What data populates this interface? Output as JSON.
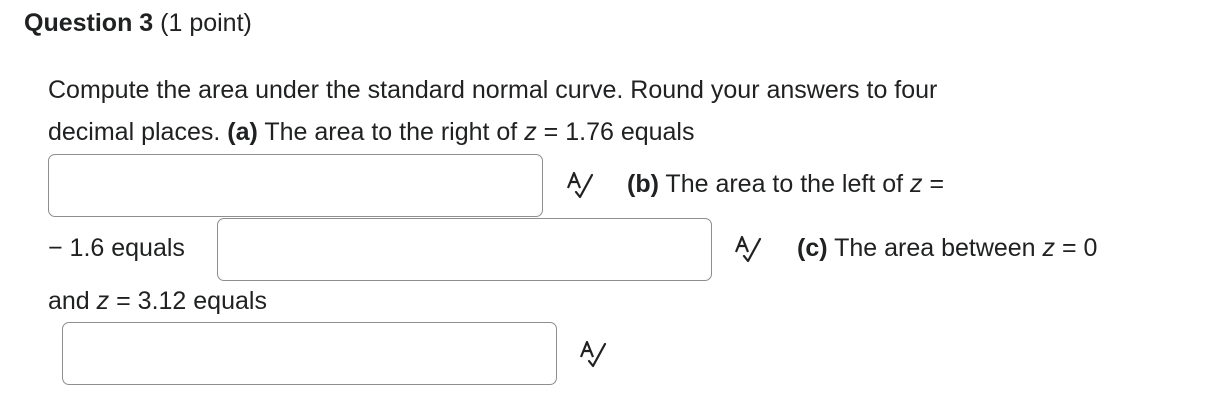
{
  "question": {
    "title": "Question 3",
    "points": "(1 point)"
  },
  "prompt": {
    "line1": "Compute the area under the standard normal curve. Round your answers to four",
    "line2_pre": "decimal places.",
    "part_a_label": "(a)",
    "part_a_text_pre": "The area to the right of",
    "var_z": "z",
    "part_a_text_post": "= 1.76 equals",
    "part_b_label": "(b)",
    "part_b_text_pre": "The area to the left of",
    "part_b_text_post": "=",
    "part_b_cont": "− 1.6 equals",
    "part_c_label": "(c)",
    "part_c_text_pre": "The area between",
    "part_c_text_mid": "= 0",
    "part_c_cont_pre": "and",
    "part_c_cont_post": "= 3.12 equals"
  },
  "answers": {
    "a_value": "",
    "b_value": "",
    "c_value": ""
  },
  "icons": {
    "spell_check": "spell-check-icon"
  },
  "colors": {
    "text": "#202122",
    "input_border": "#8e8e8e",
    "background": "#ffffff"
  }
}
